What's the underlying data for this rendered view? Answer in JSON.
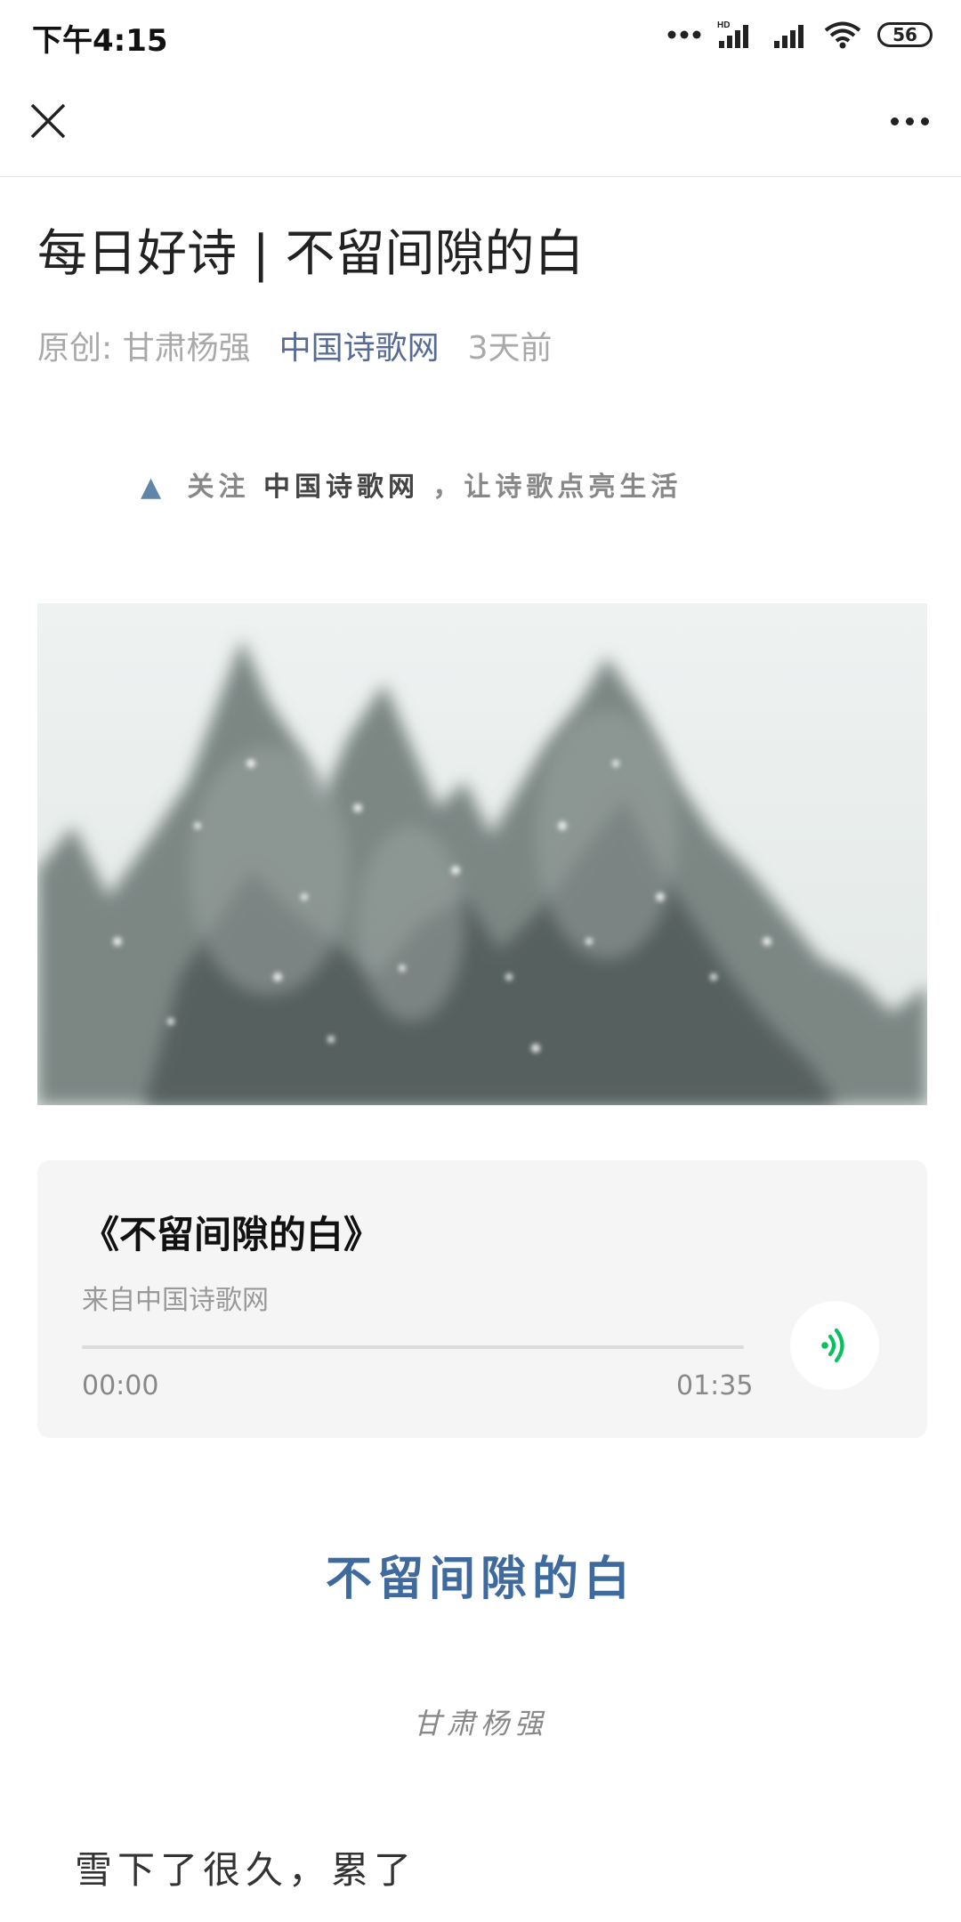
{
  "status_bar": {
    "time": "下午4:15",
    "battery": "56"
  },
  "article": {
    "title": "每日好诗 | 不留间隙的白",
    "meta_author": "原创: 甘肃杨强",
    "meta_account": "中国诗歌网",
    "meta_time": "3天前"
  },
  "follow": {
    "prefix": "关注",
    "name": "中国诗歌网",
    "suffix": "，让诗歌点亮生活"
  },
  "audio": {
    "title": "《不留间隙的白》",
    "source": "来自中国诗歌网",
    "current_time": "00:00",
    "duration": "01:35",
    "progress": 0
  },
  "poem": {
    "title": "不留间隙的白",
    "author": "甘肃杨强",
    "lines": [
      "雪下了很久，累了"
    ]
  },
  "icons": {
    "close": "close-icon",
    "more": "more-icon",
    "play": "audio-play-icon",
    "signal": "signal-icon",
    "wifi": "wifi-icon"
  },
  "colors": {
    "link": "#576b95",
    "poem_title": "#3e6a9e",
    "audio_accent": "#07c160"
  }
}
